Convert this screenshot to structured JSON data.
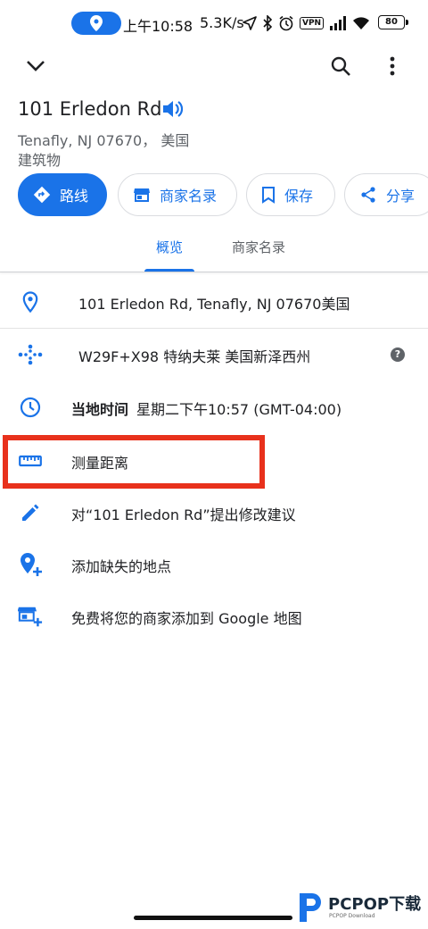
{
  "status_bar": {
    "time": "上午10:58",
    "net_speed": "5.3K/s",
    "vpn_label": "VPN",
    "battery": "80"
  },
  "place": {
    "name": "101 Erledon Rd",
    "locality": "Tenafly, NJ 07670， 美国",
    "category": "建筑物"
  },
  "actions": [
    {
      "label": "路线",
      "icon": "directions-icon"
    },
    {
      "label": "商家名录",
      "icon": "storefront-icon"
    },
    {
      "label": "保存",
      "icon": "bookmark-icon"
    },
    {
      "label": "分享",
      "icon": "share-icon"
    }
  ],
  "tabs": [
    {
      "label": "概览",
      "active": true
    },
    {
      "label": "商家名录",
      "active": false
    }
  ],
  "details": {
    "address": "101 Erledon Rd, Tenafly, NJ 07670美国",
    "plus_code": "W29F+X98 特纳夫莱 美国新泽西州",
    "local_time_label": "当地时间",
    "local_time_value": "星期二下午10:57 (GMT-04:00)",
    "measure_distance": "测量距离",
    "suggest_edit": "对“101 Erledon Rd”提出修改建议",
    "add_missing_place": "添加缺失的地点",
    "add_business": "免费将您的商家添加到 Google 地图"
  },
  "watermark": {
    "brand": "PCPOP下载",
    "sub": "PCPOP Download"
  },
  "colors": {
    "accent": "#1a73e8",
    "highlight": "#e8311c",
    "text_secondary": "#5f6368"
  }
}
